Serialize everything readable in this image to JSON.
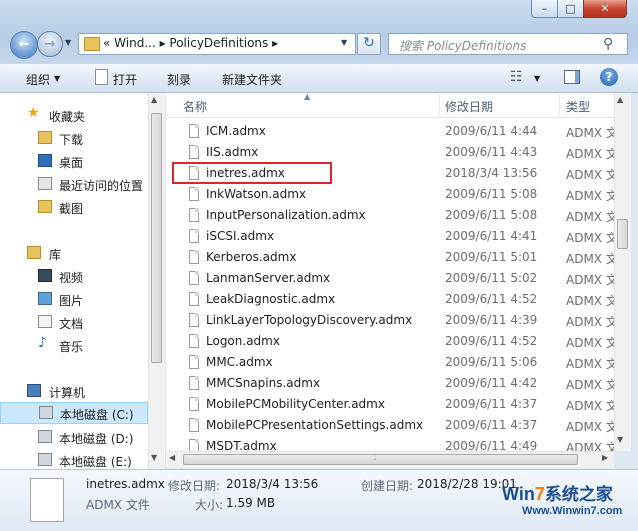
{
  "window": {
    "minimize_glyph": "–",
    "maximize_glyph": "□",
    "close_glyph": "✕"
  },
  "nav": {
    "back_glyph": "←",
    "forward_glyph": "→",
    "history_glyph": "▼"
  },
  "address": {
    "path": "«  Wind...  ▸  PolicyDefinitions  ▸",
    "dropdown_glyph": "▼",
    "refresh_glyph": "↻"
  },
  "search": {
    "placeholder": "搜索 PolicyDefinitions",
    "icon_glyph": "⚲"
  },
  "toolbar": {
    "organize": "组织",
    "arrow": "▼",
    "open": "打开",
    "burn": "刻录",
    "new_folder": "新建文件夹",
    "view_glyph": "☷",
    "help_glyph": "?"
  },
  "sidebar": {
    "favorites": {
      "label": "收藏夹",
      "icon": "star-icon"
    },
    "favorite_items": [
      {
        "label": "下载",
        "icon": "downloads-folder-icon"
      },
      {
        "label": "桌面",
        "icon": "desktop-icon"
      },
      {
        "label": "最近访问的位置",
        "icon": "recent-places-icon"
      },
      {
        "label": "截图",
        "icon": "folder-icon"
      }
    ],
    "libraries": {
      "label": "库",
      "icon": "library-icon"
    },
    "library_items": [
      {
        "label": "视频",
        "icon": "video-library-icon"
      },
      {
        "label": "图片",
        "icon": "pictures-library-icon"
      },
      {
        "label": "文档",
        "icon": "documents-library-icon"
      },
      {
        "label": "音乐",
        "icon": "music-library-icon"
      }
    ],
    "computer": {
      "label": "计算机",
      "icon": "computer-icon"
    },
    "drives": [
      {
        "label": "本地磁盘 (C:)",
        "selected": true
      },
      {
        "label": "本地磁盘 (D:)"
      },
      {
        "label": "本地磁盘 (E:)"
      }
    ]
  },
  "columns": {
    "name": "名称",
    "date": "修改日期",
    "type": "类型",
    "sort_glyph": "▲"
  },
  "files": [
    {
      "name": "ICM.admx",
      "date": "2009/6/11 4:44",
      "type": "ADMX 文"
    },
    {
      "name": "IIS.admx",
      "date": "2009/6/11 4:43",
      "type": "ADMX 文"
    },
    {
      "name": "inetres.admx",
      "date": "2018/3/4 13:56",
      "type": "ADMX 文",
      "highlighted": true
    },
    {
      "name": "InkWatson.admx",
      "date": "2009/6/11 5:08",
      "type": "ADMX 文"
    },
    {
      "name": "InputPersonalization.admx",
      "date": "2009/6/11 5:08",
      "type": "ADMX 文"
    },
    {
      "name": "iSCSI.admx",
      "date": "2009/6/11 4:41",
      "type": "ADMX 文"
    },
    {
      "name": "Kerberos.admx",
      "date": "2009/6/11 5:01",
      "type": "ADMX 文"
    },
    {
      "name": "LanmanServer.admx",
      "date": "2009/6/11 5:02",
      "type": "ADMX 文"
    },
    {
      "name": "LeakDiagnostic.admx",
      "date": "2009/6/11 4:52",
      "type": "ADMX 文"
    },
    {
      "name": "LinkLayerTopologyDiscovery.admx",
      "date": "2009/6/11 4:39",
      "type": "ADMX 文"
    },
    {
      "name": "Logon.admx",
      "date": "2009/6/11 4:52",
      "type": "ADMX 文"
    },
    {
      "name": "MMC.admx",
      "date": "2009/6/11 5:06",
      "type": "ADMX 文"
    },
    {
      "name": "MMCSnapins.admx",
      "date": "2009/6/11 4:42",
      "type": "ADMX 文"
    },
    {
      "name": "MobilePCMobilityCenter.admx",
      "date": "2009/6/11 4:37",
      "type": "ADMX 文"
    },
    {
      "name": "MobilePCPresentationSettings.admx",
      "date": "2009/6/11 4:37",
      "type": "ADMX 文"
    },
    {
      "name": "MSDT.admx",
      "date": "2009/6/11 4:49",
      "type": "ADMX 文"
    }
  ],
  "scroll": {
    "up": "▲",
    "down": "▼",
    "left": "◀",
    "right": "▶",
    "grip": "⦙"
  },
  "details": {
    "name": "inetres.admx",
    "type": "ADMX 文件",
    "modified_label": "修改日期:",
    "modified_value": "2018/3/4 13:56",
    "size_label": "大小:",
    "size_value": "1.59 MB",
    "created_label": "创建日期:",
    "created_value": "2018/2/28 19:01"
  },
  "watermark": {
    "brand_a": "Win",
    "brand_seven": "7",
    "brand_b": "系统之家",
    "url": "Www.Winwin7.com"
  },
  "colors": {
    "highlight_border": "#d9262c",
    "selected_drive_bg": "#cce8ff",
    "accent_blue": "#1f5ea8"
  }
}
